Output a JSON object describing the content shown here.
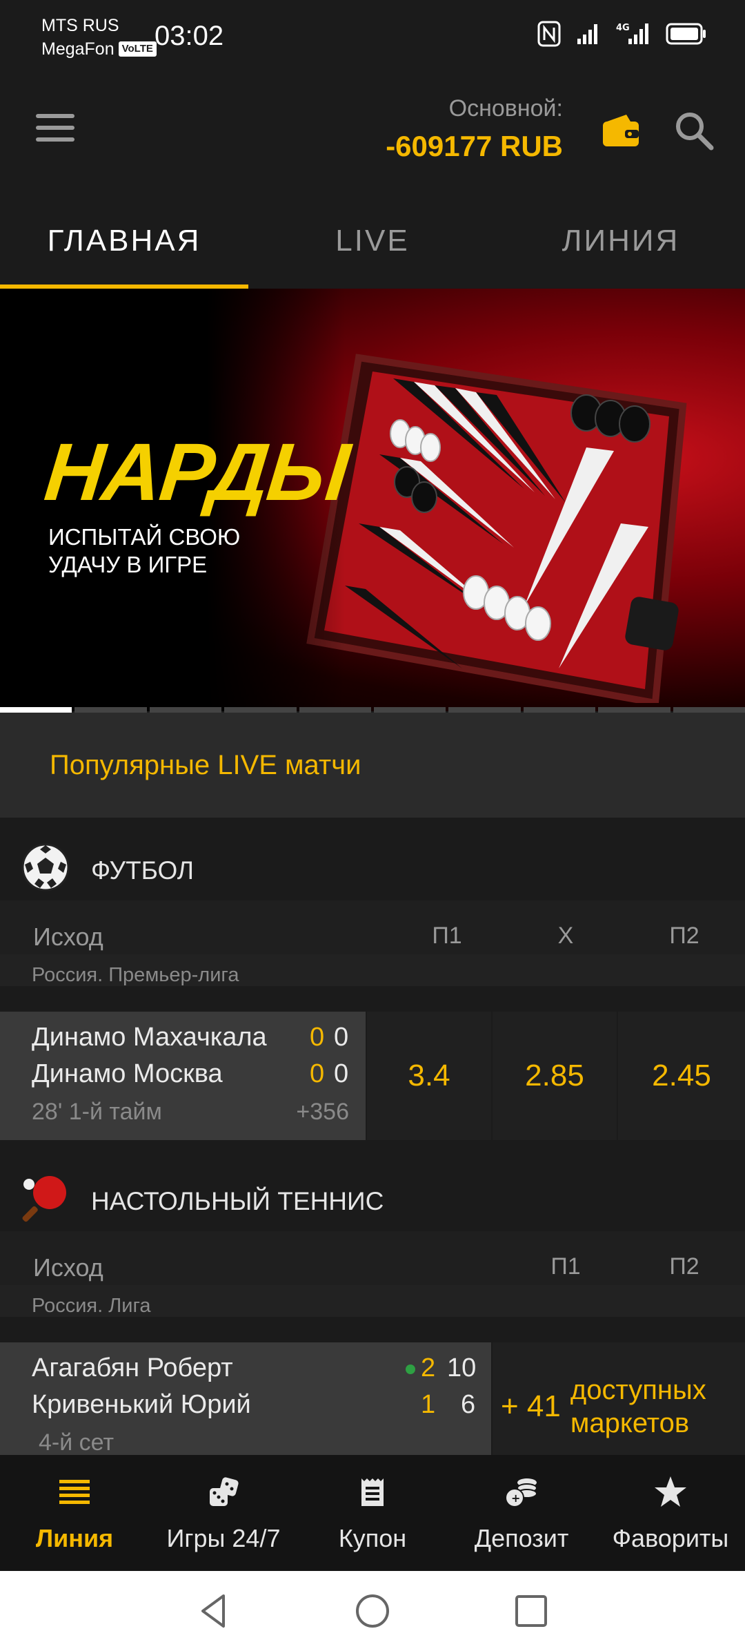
{
  "status_bar": {
    "carrier1": "MTS RUS",
    "carrier2": "MegaFon",
    "volte": "VoLTE",
    "time": "03:02"
  },
  "header": {
    "balance_label": "Основной:",
    "balance_value": "-609177 RUB"
  },
  "tabs": [
    {
      "label": "ГЛАВНАЯ",
      "active": true
    },
    {
      "label": "LIVE",
      "active": false
    },
    {
      "label": "ЛИНИЯ",
      "active": false
    }
  ],
  "banner": {
    "title": "НАРДЫ",
    "subtitle": "ИСПЫТАЙ СВОЮ УДАЧУ В ИГРЕ",
    "slides_total": 10,
    "active_slide": 1
  },
  "popular": {
    "heading": "Популярные LIVE матчи"
  },
  "football": {
    "sport_name": "ФУТБОЛ",
    "outcome_label": "Исход",
    "columns": [
      "П1",
      "X",
      "П2"
    ],
    "league": "Россия. Премьер-лига",
    "match": {
      "team1": "Динамо Махачкала",
      "team2": "Динамо Москва",
      "team1_score_a": "0",
      "team1_score_b": "0",
      "team2_score_a": "0",
      "team2_score_b": "0",
      "time": "28' 1-й тайм",
      "more": "+356",
      "odds": [
        "3.4",
        "2.85",
        "2.45"
      ]
    }
  },
  "table_tennis": {
    "sport_name": "НАСТОЛЬНЫЙ ТЕННИС",
    "outcome_label": "Исход",
    "columns": [
      "П1",
      "П2"
    ],
    "league": "Россия. Лига",
    "match": {
      "team1": "Агагабян Роберт",
      "team2": "Кривенький Юрий",
      "team1_set": "2",
      "team1_points": "10",
      "team2_set": "1",
      "team2_points": "6",
      "period": "4-й сет",
      "markets_count": "+ 41",
      "markets_text": "доступных маркетов"
    }
  },
  "bottom_nav": [
    {
      "label": "Линия",
      "icon": "list-icon",
      "active": true
    },
    {
      "label": "Игры 24/7",
      "icon": "dice-icon",
      "active": false
    },
    {
      "label": "Купон",
      "icon": "coupon-icon",
      "active": false
    },
    {
      "label": "Депозит",
      "icon": "coins-icon",
      "active": false
    },
    {
      "label": "Фавориты",
      "icon": "star-icon",
      "active": false
    }
  ],
  "colors": {
    "accent": "#f5b800",
    "background": "#1b1b1b",
    "panel": "#3a3a3a"
  }
}
